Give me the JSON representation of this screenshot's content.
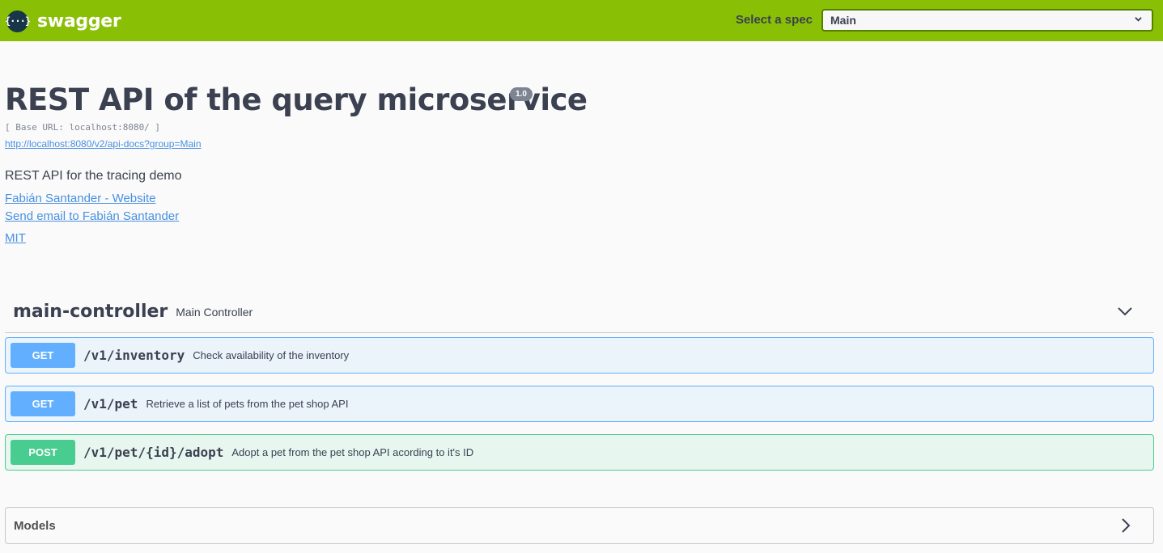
{
  "topbar": {
    "logo_icon": "{···}",
    "logo_text": "swagger",
    "spec_label": "Select a spec",
    "spec_selected": "Main"
  },
  "info": {
    "title": "REST API of the query microservice",
    "version": "1.0",
    "base_url": "[ Base URL: localhost:8080/ ]",
    "api_docs_link": "http://localhost:8080/v2/api-docs?group=Main",
    "description": "REST API for the tracing demo",
    "website_link": "Fabián Santander - Website",
    "email_link": "Send email to Fabián Santander",
    "license_link": "MIT"
  },
  "tag": {
    "name": "main-controller",
    "description": "Main Controller"
  },
  "operations": [
    {
      "method": "GET",
      "path": "/v1/inventory",
      "summary": "Check availability of the inventory"
    },
    {
      "method": "GET",
      "path": "/v1/pet",
      "summary": "Retrieve a list of pets from the pet shop API"
    },
    {
      "method": "POST",
      "path": "/v1/pet/{id}/adopt",
      "summary": "Adopt a pet from the pet shop API acording to it's ID"
    }
  ],
  "models": {
    "title": "Models"
  },
  "colors": {
    "topbar": "#89bf04",
    "get": "#61affe",
    "post": "#49cc90",
    "link": "#4990e2"
  }
}
